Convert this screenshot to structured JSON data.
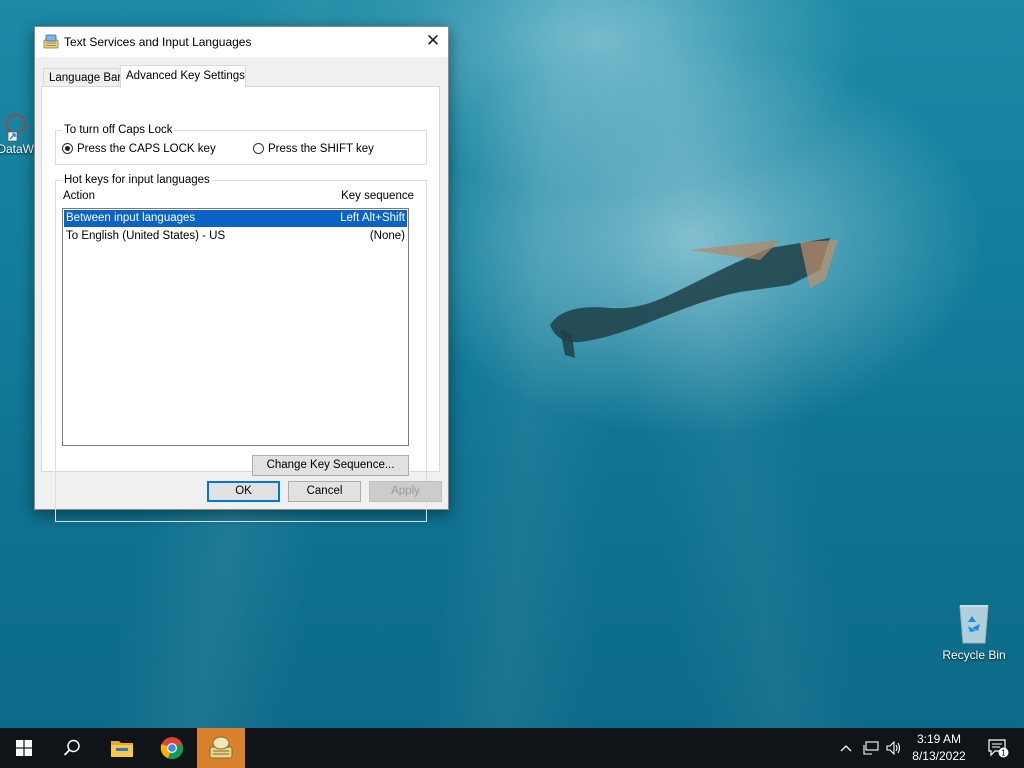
{
  "desktop": {
    "icons": [
      {
        "label": "DataW"
      },
      {
        "label": "Recycle Bin"
      }
    ]
  },
  "dialog": {
    "title": "Text Services and Input Languages",
    "tabs": [
      {
        "label": "Language Bar",
        "active": false
      },
      {
        "label": "Advanced Key Settings",
        "active": true
      }
    ],
    "caps_lock": {
      "legend": "To turn off Caps Lock",
      "options": [
        {
          "label": "Press the CAPS LOCK key",
          "selected": true
        },
        {
          "label": "Press the SHIFT key",
          "selected": false
        }
      ]
    },
    "hotkeys": {
      "legend": "Hot keys for input languages",
      "columns": [
        "Action",
        "Key sequence"
      ],
      "rows": [
        {
          "action": "Between input languages",
          "key": "Left Alt+Shift",
          "selected": true
        },
        {
          "action": "To English (United States) - US",
          "key": "(None)",
          "selected": false
        }
      ],
      "change_button": "Change Key Sequence..."
    },
    "buttons": {
      "ok": "OK",
      "cancel": "Cancel",
      "apply": "Apply"
    }
  },
  "taskbar": {
    "apps": [
      "start-icon",
      "search-icon",
      "file-explorer-icon",
      "chrome-icon",
      "language-settings-icon"
    ],
    "clock_time": "3:19 AM",
    "clock_date": "8/13/2022",
    "notification_count": "1"
  }
}
